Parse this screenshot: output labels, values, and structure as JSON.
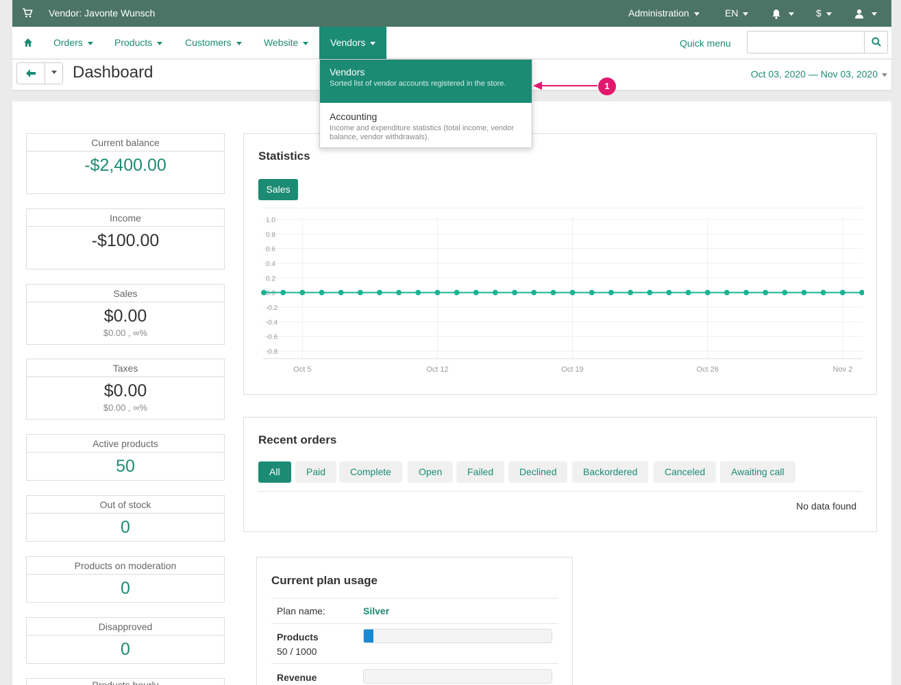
{
  "topbar": {
    "vendor_label": "Vendor: Javonte Wunsch",
    "administration": "Administration",
    "language": "EN",
    "currency": "$",
    "icons": [
      "cart-icon",
      "bell-icon",
      "user-icon"
    ]
  },
  "nav": {
    "items": [
      "Orders",
      "Products",
      "Customers",
      "Website",
      "Vendors"
    ],
    "active": "Vendors",
    "quick_menu": "Quick menu",
    "search_placeholder": ""
  },
  "header": {
    "title": "Dashboard",
    "date_range": "Oct 03, 2020 — Nov 03, 2020"
  },
  "dropdown": {
    "items": [
      {
        "title": "Vendors",
        "desc": "Sorted list of vendor accounts registered in the store."
      },
      {
        "title": "Accounting",
        "desc": "Income and expenditure statistics (total income, vendor balance, vendor withdrawals)."
      }
    ]
  },
  "annotation": {
    "number": "1",
    "color": "#e0196e"
  },
  "stats": [
    {
      "label": "Current balance",
      "value": "-$2,400.00",
      "sub": ""
    },
    {
      "label": "Income",
      "value": "-$100.00",
      "sub": ""
    },
    {
      "label": "Sales",
      "value": "$0.00",
      "sub": "$0.00 , ∞%"
    },
    {
      "label": "Taxes",
      "value": "$0.00",
      "sub": "$0.00 , ∞%"
    },
    {
      "label": "Active products",
      "value": "50",
      "sub": ""
    },
    {
      "label": "Out of stock",
      "value": "0",
      "sub": ""
    },
    {
      "label": "Products on moderation",
      "value": "0",
      "sub": ""
    },
    {
      "label": "Disapproved",
      "value": "0",
      "sub": ""
    },
    {
      "label": "Products hourly",
      "value": "",
      "sub": ""
    }
  ],
  "statistics": {
    "title": "Statistics",
    "tab": "Sales"
  },
  "chart_data": {
    "type": "line",
    "title": "",
    "xlabel": "",
    "ylabel": "",
    "ylim": [
      -0.8,
      1.0
    ],
    "y_ticks": [
      "1.0",
      "0.8",
      "0.6",
      "0.4",
      "0.2",
      "0.0",
      "-0.2",
      "-0.4",
      "-0.6",
      "-0.8"
    ],
    "x_ticks": [
      "Oct 5",
      "Oct 12",
      "Oct 19",
      "Oct 26",
      "Nov 2"
    ],
    "x": [
      "Oct 3",
      "Oct 4",
      "Oct 5",
      "Oct 6",
      "Oct 7",
      "Oct 8",
      "Oct 9",
      "Oct 10",
      "Oct 11",
      "Oct 12",
      "Oct 13",
      "Oct 14",
      "Oct 15",
      "Oct 16",
      "Oct 17",
      "Oct 18",
      "Oct 19",
      "Oct 20",
      "Oct 21",
      "Oct 22",
      "Oct 23",
      "Oct 24",
      "Oct 25",
      "Oct 26",
      "Oct 27",
      "Oct 28",
      "Oct 29",
      "Oct 30",
      "Oct 31",
      "Nov 1",
      "Nov 2",
      "Nov 3"
    ],
    "series": [
      {
        "values": [
          0,
          0,
          0,
          0,
          0,
          0,
          0,
          0,
          0,
          0,
          0,
          0,
          0,
          0,
          0,
          0,
          0,
          0,
          0,
          0,
          0,
          0,
          0,
          0,
          0,
          0,
          0,
          0,
          0,
          0,
          0,
          0
        ],
        "color": "#1ab394"
      }
    ],
    "grid": true
  },
  "recent_orders": {
    "title": "Recent orders",
    "filters": [
      "All",
      "Paid",
      "Complete",
      "Open",
      "Failed",
      "Declined",
      "Backordered",
      "Canceled",
      "Awaiting call"
    ],
    "active_filter": "All",
    "empty_text": "No data found"
  },
  "plan": {
    "title": "Current plan usage",
    "name_label": "Plan name:",
    "name_value": "Silver",
    "products_label": "Products",
    "products_usage": "50 / 1000",
    "products_fraction": 0.05,
    "revenue_label": "Revenue"
  },
  "colors": {
    "brand_dark": "#4c7466",
    "accent": "#1c8b73",
    "chart_line": "#1ab394",
    "progress": "#1a8ad3"
  }
}
